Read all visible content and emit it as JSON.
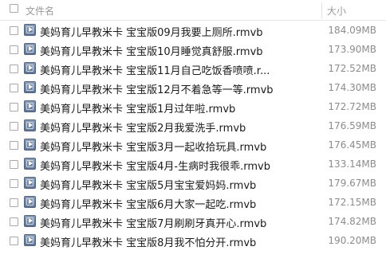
{
  "header": {
    "name_label": "文件名",
    "size_label": "大小"
  },
  "files": [
    {
      "name": "美妈育儿早教米卡 宝宝版09月我要上厕所.rmvb",
      "size": "184.09MB"
    },
    {
      "name": "美妈育儿早教米卡 宝宝版10月睡觉真舒服.rmvb",
      "size": "173.90MB"
    },
    {
      "name": "美妈育儿早教米卡 宝宝版11月自己吃饭香喷喷.r...",
      "size": "172.52MB"
    },
    {
      "name": "美妈育儿早教米卡 宝宝版12月不着急等一等.rmvb",
      "size": "174.30MB"
    },
    {
      "name": "美妈育儿早教米卡 宝宝版1月过年啦.rmvb",
      "size": "172.72MB"
    },
    {
      "name": "美妈育儿早教米卡 宝宝版2月我爱洗手.rmvb",
      "size": "176.59MB"
    },
    {
      "name": "美妈育儿早教米卡 宝宝版3月一起收拾玩具.rmvb",
      "size": "176.45MB"
    },
    {
      "name": "美妈育儿早教米卡 宝宝版4月-生病时我很乖.rmvb",
      "size": "133.14MB"
    },
    {
      "name": "美妈育儿早教米卡 宝宝版5月宝宝爱妈妈.rmvb",
      "size": "179.67MB"
    },
    {
      "name": "美妈育儿早教米卡 宝宝版6月大家一起吃.rmvb",
      "size": "172.15MB"
    },
    {
      "name": "美妈育儿早教米卡 宝宝版7月刷刷牙真开心.rmvb",
      "size": "174.82MB"
    },
    {
      "name": "美妈育儿早教米卡 宝宝版8月我不怕分开.rmvb",
      "size": "190.20MB"
    }
  ]
}
